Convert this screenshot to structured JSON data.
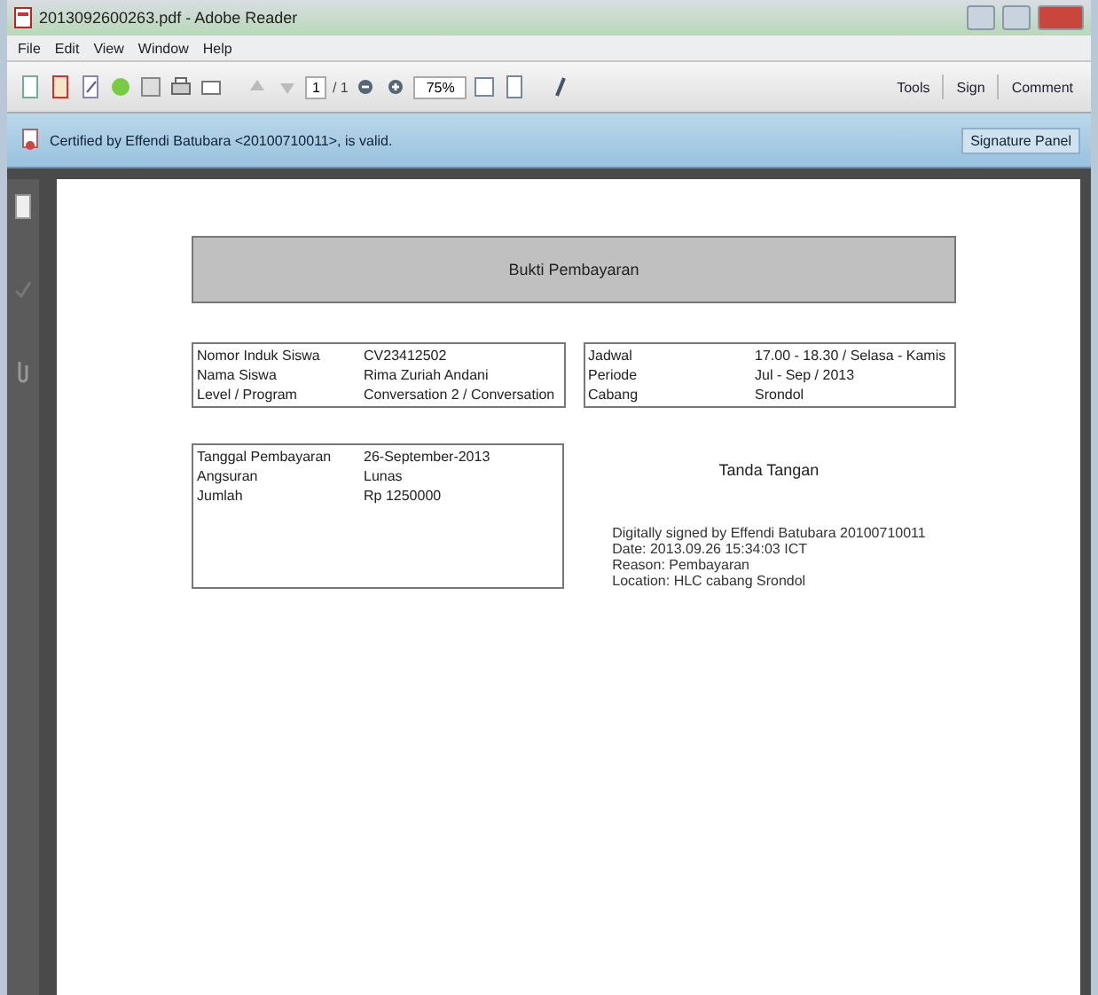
{
  "window": {
    "title": "2013092600263.pdf - Adobe Reader"
  },
  "menu": [
    "File",
    "Edit",
    "View",
    "Window",
    "Help"
  ],
  "toolbar": {
    "page": "1",
    "page_total": "/ 1",
    "zoom": "75%",
    "actions": [
      "Tools",
      "Sign",
      "Comment"
    ]
  },
  "banner": {
    "message": "Certified by Effendi Batubara <20100710011>, is valid.",
    "button": "Signature Panel"
  },
  "document": {
    "heading": "Bukti Pembayaran",
    "student": [
      {
        "label": "Nomor Induk Siswa",
        "value": "CV23412502"
      },
      {
        "label": "Nama Siswa",
        "value": "Rima Zuriah Andani"
      },
      {
        "label": "Level / Program",
        "value": "Conversation 2 / Conversation"
      }
    ],
    "schedule": [
      {
        "label": "Jadwal",
        "value": "17.00 - 18.30 / Selasa - Kamis"
      },
      {
        "label": "Periode",
        "value": "Jul - Sep / 2013"
      },
      {
        "label": "Cabang",
        "value": "Srondol"
      }
    ],
    "payment": [
      {
        "label": "Tanggal Pembayaran",
        "value": "26-September-2013"
      },
      {
        "label": "Angsuran",
        "value": "Lunas"
      },
      {
        "label": "Jumlah",
        "value": "Rp 1250000"
      }
    ],
    "signature_title": "Tanda Tangan",
    "signature_lines": [
      "Digitally signed by Effendi Batubara 20100710011",
      "Date: 2013.09.26 15:34:03 ICT",
      "Reason: Pembayaran",
      "Location: HLC cabang Srondol"
    ]
  }
}
